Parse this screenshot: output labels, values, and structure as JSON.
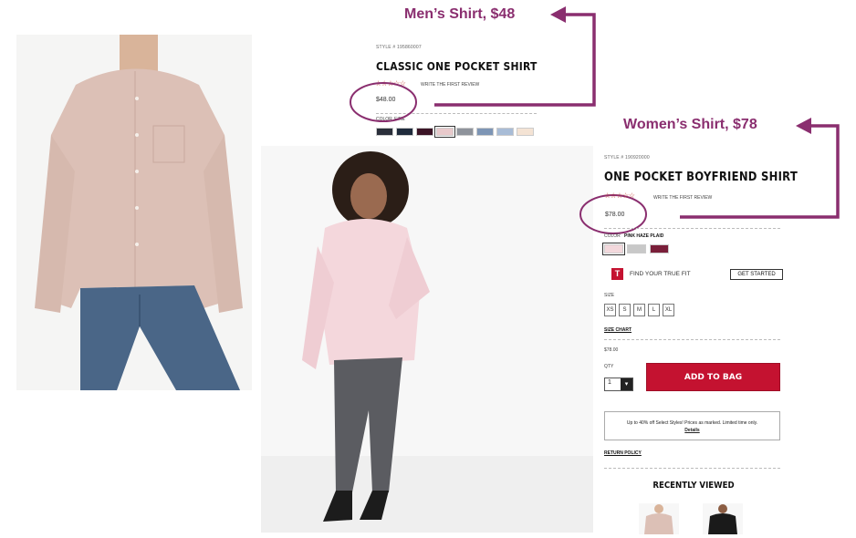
{
  "annotations": {
    "men_label": "Men’s Shirt, $48",
    "women_label": "Women’s Shirt, $78",
    "color": "#8a2e6f"
  },
  "men_product": {
    "style_number": "STYLE # 195860007",
    "title": "CLASSIC ONE POCKET SHIRT",
    "stars": "☆☆☆☆☆",
    "review_link": "WRITE THE FIRST REVIEW",
    "price": "$48.00",
    "color_label": "COLOR",
    "color_value": "EIRE",
    "swatches": [
      "#2a2f3a",
      "#1f2b3c",
      "#3b1426",
      "#e8c9cb",
      "#8e939b",
      "#7d95b5",
      "#a8bcd6",
      "#f4e3d4"
    ]
  },
  "women_product": {
    "style_number": "STYLE # 190920000",
    "title": "ONE POCKET BOYFRIEND SHIRT",
    "stars": "☆☆☆☆☆",
    "review_link": "WRITE THE FIRST REVIEW",
    "price": "$78.00",
    "color_label": "COLOR",
    "color_value": "PINK HAZE PLAID",
    "swatches": [
      "#f3d8dc",
      "#c8c8c8",
      "#7a1f3a"
    ],
    "fit_icon": "T",
    "fit_text": "FIND YOUR TRUE FIT",
    "get_started": "GET STARTED",
    "size_label": "SIZE",
    "sizes": [
      "XS",
      "S",
      "M",
      "L",
      "XL"
    ],
    "size_chart": "SIZE CHART",
    "unit_price": "$78.00",
    "qty_label": "QTY",
    "qty_value": "1",
    "add_to_bag": "ADD TO BAG",
    "promo_line1": "Up to 40% off Select Styles! Prices as marked. Limited time only.",
    "promo_details": "Details",
    "return_policy": "RETURN POLICY",
    "recently_viewed": "RECENTLY VIEWED"
  }
}
